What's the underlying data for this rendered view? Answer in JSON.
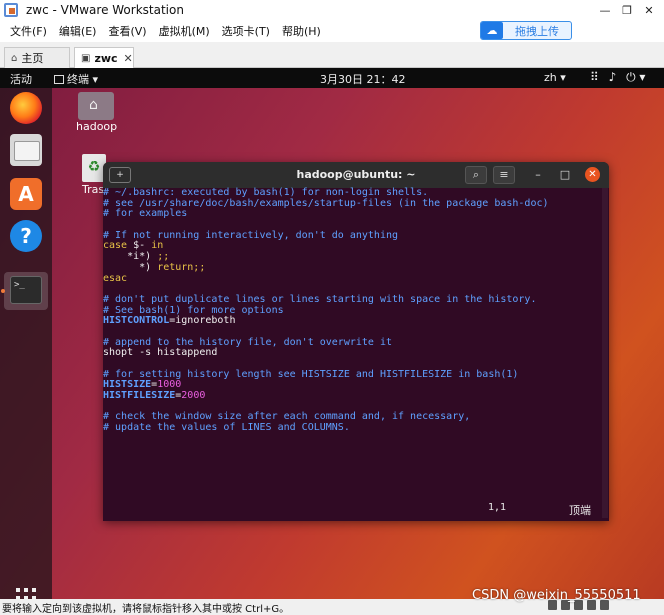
{
  "window": {
    "title": "zwc - VMware Workstation",
    "controls": [
      "—",
      "❐",
      "✕"
    ]
  },
  "menu": {
    "items": [
      "文件(F)",
      "编辑(E)",
      "查看(V)",
      "虚拟机(M)",
      "选项卡(T)",
      "帮助(H)"
    ],
    "upload_label": "拖拽上传"
  },
  "tabs": [
    {
      "label": "主页",
      "icon": "home-icon"
    },
    {
      "label": "zwc",
      "icon": "vm-icon"
    }
  ],
  "ubuntu": {
    "activities": "活动",
    "app_menu": "终端 ▾",
    "clock": "3月30日 21：42",
    "lang": "zh ▾",
    "sys_icons": [
      "network-icon",
      "volume-icon",
      "power-icon"
    ]
  },
  "desktop": {
    "home_label": "hadoop",
    "trash_label": "Tras"
  },
  "terminal": {
    "title": "hadoop@ubuntu: ~",
    "lines": [
      [
        {
          "t": "# ~/.bashrc: executed by bash(1) for non-login shells.",
          "c": "c-comment"
        }
      ],
      [
        {
          "t": "# see /usr/share/doc/bash/examples/startup-files (in the package bash-doc)",
          "c": "c-comment"
        }
      ],
      [
        {
          "t": "# for examples",
          "c": "c-comment"
        }
      ],
      [
        {
          "t": "",
          "c": "c-plain"
        }
      ],
      [
        {
          "t": "# If not running interactively, don't do anything",
          "c": "c-comment"
        }
      ],
      [
        {
          "t": "case",
          "c": "c-keyword"
        },
        {
          "t": " $- ",
          "c": "c-white"
        },
        {
          "t": "in",
          "c": "c-keyword"
        }
      ],
      [
        {
          "t": "    *i*) ",
          "c": "c-white"
        },
        {
          "t": ";;",
          "c": "c-keyword"
        }
      ],
      [
        {
          "t": "      *) ",
          "c": "c-white"
        },
        {
          "t": "return;;",
          "c": "c-keyword"
        }
      ],
      [
        {
          "t": "esac",
          "c": "c-keyword"
        }
      ],
      [
        {
          "t": "",
          "c": "c-plain"
        }
      ],
      [
        {
          "t": "# don't put duplicate lines or lines starting with space in the history.",
          "c": "c-comment"
        }
      ],
      [
        {
          "t": "# See bash(1) for more options",
          "c": "c-comment"
        }
      ],
      [
        {
          "t": "HISTCONTROL",
          "c": "c-var"
        },
        {
          "t": "=ignoreboth",
          "c": "c-white"
        }
      ],
      [
        {
          "t": "",
          "c": "c-plain"
        }
      ],
      [
        {
          "t": "# append to the history file, don't overwrite it",
          "c": "c-comment"
        }
      ],
      [
        {
          "t": "shopt -s histappend",
          "c": "c-white"
        }
      ],
      [
        {
          "t": "",
          "c": "c-plain"
        }
      ],
      [
        {
          "t": "# for setting history length see HISTSIZE and HISTFILESIZE in bash(1)",
          "c": "c-comment"
        }
      ],
      [
        {
          "t": "HISTSIZE",
          "c": "c-var"
        },
        {
          "t": "=",
          "c": "c-white"
        },
        {
          "t": "1000",
          "c": "c-num"
        }
      ],
      [
        {
          "t": "HISTFILESIZE",
          "c": "c-var"
        },
        {
          "t": "=",
          "c": "c-white"
        },
        {
          "t": "2000",
          "c": "c-num"
        }
      ],
      [
        {
          "t": "",
          "c": "c-plain"
        }
      ],
      [
        {
          "t": "# check the window size after each command and, if necessary,",
          "c": "c-comment"
        }
      ],
      [
        {
          "t": "# update the values of LINES and COLUMNS.",
          "c": "c-comment"
        }
      ]
    ],
    "cursor_pos": "1,1",
    "scroll_pos": "顶端"
  },
  "status": {
    "message": "要将输入定向到该虚拟机，请将鼠标指针移入其中或按 Ctrl+G。",
    "watermark": "CSDN @weixin_55550511"
  }
}
